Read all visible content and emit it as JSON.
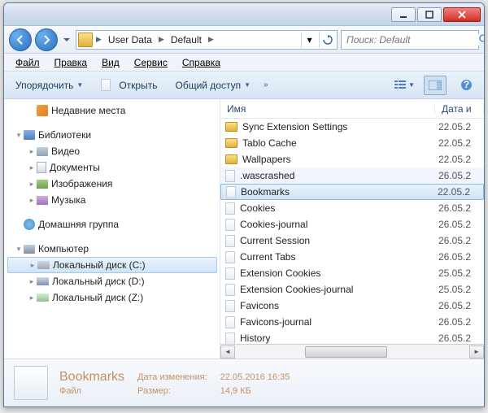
{
  "breadcrumbs": [
    "User Data",
    "Default"
  ],
  "search": {
    "placeholder": "Поиск: Default"
  },
  "menu": {
    "file": "Файл",
    "edit": "Правка",
    "view": "Вид",
    "tools": "Сервис",
    "help": "Справка"
  },
  "toolbar": {
    "organize": "Упорядочить",
    "open": "Открыть",
    "share": "Общий доступ"
  },
  "columns": {
    "name": "Имя",
    "date": "Дата и"
  },
  "tree": {
    "recent": "Недавние места",
    "libraries": "Библиотеки",
    "videos": "Видео",
    "documents": "Документы",
    "pictures": "Изображения",
    "music": "Музыка",
    "homegroup": "Домашняя группа",
    "computer": "Компьютер",
    "drive_c": "Локальный диск (C:)",
    "drive_d": "Локальный диск (D:)",
    "drive_z": "Локальный диск (Z:)"
  },
  "files": [
    {
      "type": "folder",
      "name": "Sync Extension Settings",
      "date": "22.05.2"
    },
    {
      "type": "folder",
      "name": "Tablo Cache",
      "date": "22.05.2"
    },
    {
      "type": "folder",
      "name": "Wallpapers",
      "date": "22.05.2"
    },
    {
      "type": "file",
      "name": ".wascrashed",
      "date": "26.05.2"
    },
    {
      "type": "file",
      "name": "Bookmarks",
      "date": "22.05.2",
      "selected": true
    },
    {
      "type": "file",
      "name": "Cookies",
      "date": "26.05.2"
    },
    {
      "type": "file",
      "name": "Cookies-journal",
      "date": "26.05.2"
    },
    {
      "type": "file",
      "name": "Current Session",
      "date": "26.05.2"
    },
    {
      "type": "file",
      "name": "Current Tabs",
      "date": "26.05.2"
    },
    {
      "type": "file",
      "name": "Extension Cookies",
      "date": "25.05.2"
    },
    {
      "type": "file",
      "name": "Extension Cookies-journal",
      "date": "25.05.2"
    },
    {
      "type": "file",
      "name": "Favicons",
      "date": "26.05.2"
    },
    {
      "type": "file",
      "name": "Favicons-journal",
      "date": "26.05.2"
    },
    {
      "type": "file",
      "name": "History",
      "date": "26.05.2"
    }
  ],
  "details": {
    "name": "Bookmarks",
    "modified_label": "Дата изменения:",
    "modified_value": "22.05.2016 16:35",
    "type_label": "Файл",
    "size_label": "Размер:",
    "size_value": "14,9 КБ"
  }
}
